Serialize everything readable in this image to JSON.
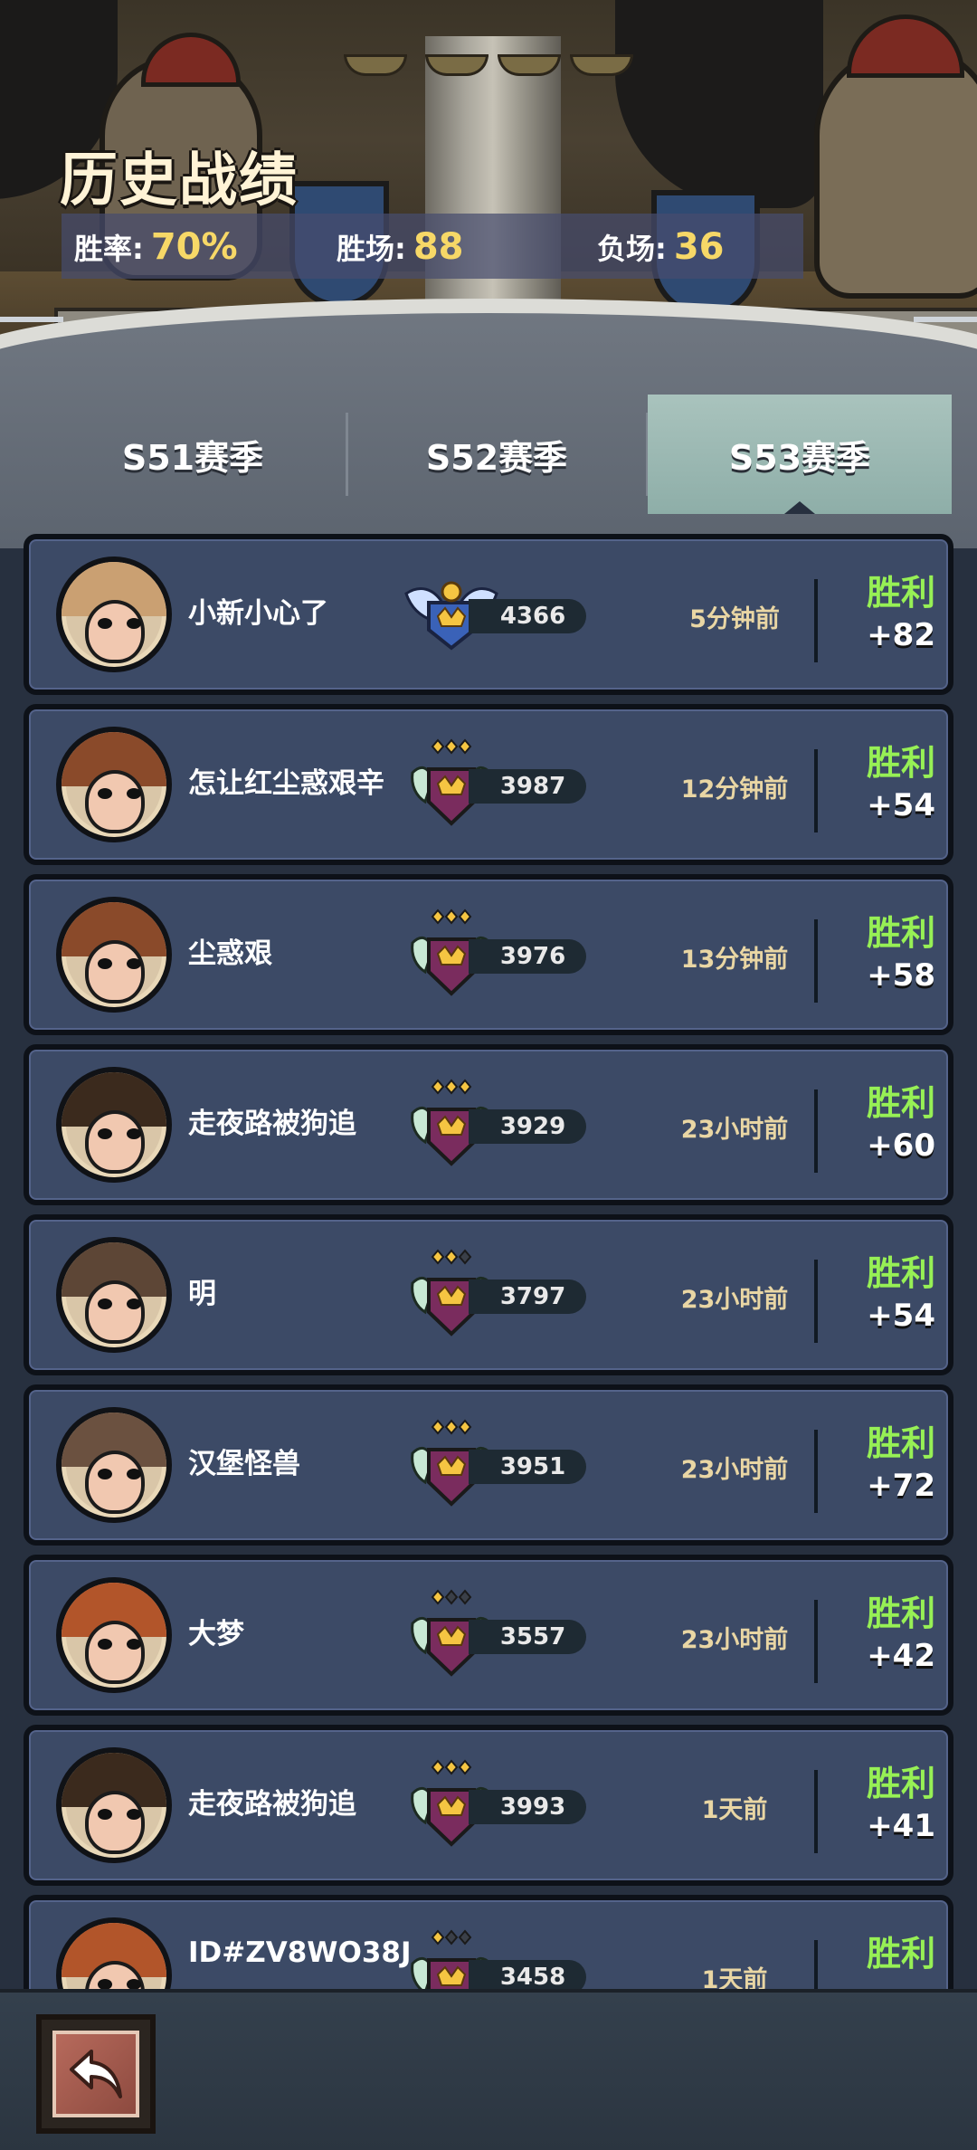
{
  "header": {
    "title": "历史战绩",
    "stats": [
      {
        "label": "胜率:",
        "value": "70%"
      },
      {
        "label": "胜场:",
        "value": "88"
      },
      {
        "label": "负场:",
        "value": "36"
      }
    ]
  },
  "tabs": [
    {
      "label": "S51赛季",
      "selected": false
    },
    {
      "label": "S52赛季",
      "selected": false
    },
    {
      "label": "S53赛季",
      "selected": true
    }
  ],
  "matches": [
    {
      "name": "小新小心了",
      "score": "4366",
      "time": "5分钟前",
      "result": "胜利",
      "delta": "+82",
      "rank_stars": 0,
      "badge": "winged-crown-badge"
    },
    {
      "name": "怎让红尘惑艰辛",
      "score": "3987",
      "time": "12分钟前",
      "result": "胜利",
      "delta": "+54",
      "rank_stars": 3,
      "badge": "crown-rank-badge"
    },
    {
      "name": "尘惑艰",
      "score": "3976",
      "time": "13分钟前",
      "result": "胜利",
      "delta": "+58",
      "rank_stars": 3,
      "badge": "crown-rank-badge"
    },
    {
      "name": "走夜路被狗追",
      "score": "3929",
      "time": "23小时前",
      "result": "胜利",
      "delta": "+60",
      "rank_stars": 3,
      "badge": "crown-rank-badge"
    },
    {
      "name": "明",
      "score": "3797",
      "time": "23小时前",
      "result": "胜利",
      "delta": "+54",
      "rank_stars": 2,
      "badge": "crown-rank-badge"
    },
    {
      "name": "汉堡怪兽",
      "score": "3951",
      "time": "23小时前",
      "result": "胜利",
      "delta": "+72",
      "rank_stars": 3,
      "badge": "crown-rank-badge"
    },
    {
      "name": "大梦",
      "score": "3557",
      "time": "23小时前",
      "result": "胜利",
      "delta": "+42",
      "rank_stars": 1,
      "badge": "crown-rank-badge"
    },
    {
      "name": "走夜路被狗追",
      "score": "3993",
      "time": "1天前",
      "result": "胜利",
      "delta": "+41",
      "rank_stars": 3,
      "badge": "crown-rank-badge"
    },
    {
      "name": "ID#ZV8WO38J",
      "score": "3458",
      "time": "1天前",
      "result": "胜利",
      "delta": "",
      "rank_stars": 1,
      "badge": "crown-rank-badge"
    }
  ],
  "colors": {
    "win": "#97f055",
    "stat_value": "#f7d867",
    "card_bg": "#3c4a66",
    "tab_active": "#a9c3bd"
  },
  "bottom": {
    "back_icon": "back-arrow-icon"
  }
}
